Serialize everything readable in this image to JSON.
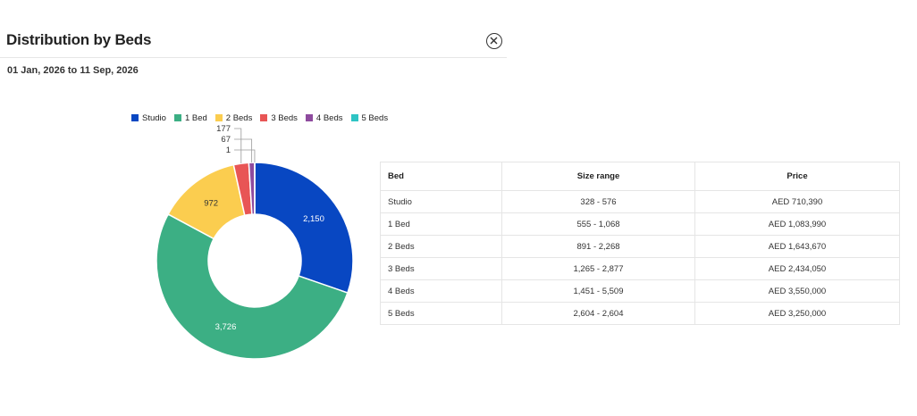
{
  "header": {
    "title": "Distribution by Beds",
    "close_icon": "close-circle-icon"
  },
  "date_range": "01 Jan, 2026 to 11 Sep, 2026",
  "chart_data": {
    "type": "pie",
    "variant": "donut",
    "legend_position": "top",
    "categories": [
      "Studio",
      "1 Bed",
      "2 Beds",
      "3 Beds",
      "4 Beds",
      "5 Beds"
    ],
    "values": [
      2150,
      3726,
      972,
      177,
      67,
      1
    ],
    "labels": [
      "2,150",
      "3,726",
      "972",
      "177",
      "67",
      "1"
    ],
    "colors": [
      "#0847c2",
      "#3caf84",
      "#fbcd4f",
      "#e85555",
      "#8e4b9e",
      "#2ec4c4"
    ]
  },
  "table": {
    "headers": [
      "Bed",
      "Size range",
      "Price"
    ],
    "rows": [
      [
        "Studio",
        "328 - 576",
        "AED 710,390"
      ],
      [
        "1 Bed",
        "555 - 1,068",
        "AED 1,083,990"
      ],
      [
        "2 Beds",
        "891 - 2,268",
        "AED 1,643,670"
      ],
      [
        "3 Beds",
        "1,265 - 2,877",
        "AED 2,434,050"
      ],
      [
        "4 Beds",
        "1,451 - 5,509",
        "AED 3,550,000"
      ],
      [
        "5 Beds",
        "2,604 - 2,604",
        "AED 3,250,000"
      ]
    ]
  }
}
